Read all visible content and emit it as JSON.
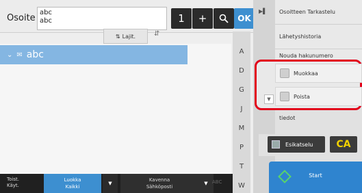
{
  "address": {
    "label": "Osoite",
    "lines": [
      "abc",
      "abc"
    ],
    "count": "1",
    "plus": "+",
    "ok": "OK"
  },
  "sort": {
    "label": "Lajit."
  },
  "list": {
    "selected_row": "abc"
  },
  "index_letters": [
    "A",
    "D",
    "G",
    "J",
    "M",
    "P",
    "T",
    "W"
  ],
  "right_panel": {
    "items": [
      "Osoitteen Tarkastelu",
      "Lähetyshistoria",
      "Nouda hakunumero"
    ],
    "submenu": [
      "Muokkaa",
      "Poista"
    ],
    "partial_text": "tiedot",
    "preview": "Esikatselu",
    "ca": "CA",
    "start": "Start"
  },
  "bottom": {
    "toist_line1": "Toist.",
    "toist_line2": "Käyt.",
    "luokka_line1": "Luokka",
    "luokka_line2": "Kaikki",
    "kavenna_line1": "Kavenna",
    "kavenna_line2": "Sähköposti",
    "abc": "ABC"
  },
  "colors": {
    "accent_blue": "#3d8fd0",
    "selection_blue": "#84b6e2",
    "highlight_red": "#e2001a",
    "ca_yellow": "#f0d000",
    "start_green": "#59d46a"
  }
}
